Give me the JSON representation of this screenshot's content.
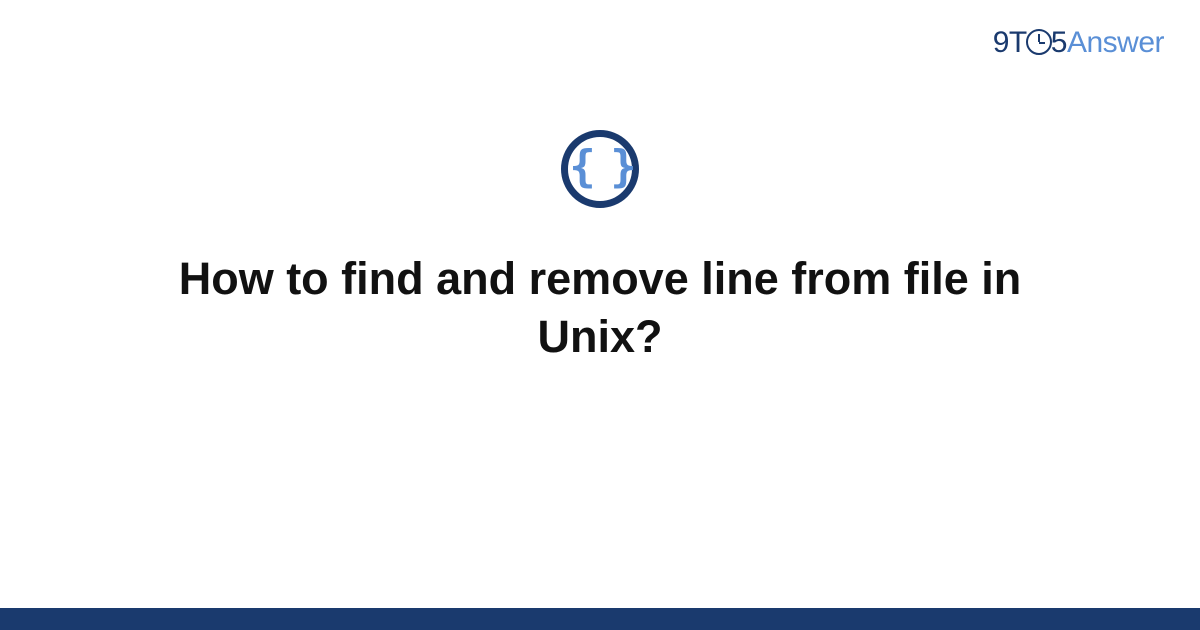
{
  "brand": {
    "prefix": "9T",
    "middle": "5",
    "suffix": "Answer"
  },
  "category_icon": {
    "glyph": "{ }",
    "name": "code-braces"
  },
  "question": {
    "title": "How to find and remove line from file in Unix?"
  },
  "colors": {
    "brand_dark": "#1a3a6e",
    "brand_light": "#5a8fd6",
    "text": "#111111",
    "background": "#ffffff"
  }
}
